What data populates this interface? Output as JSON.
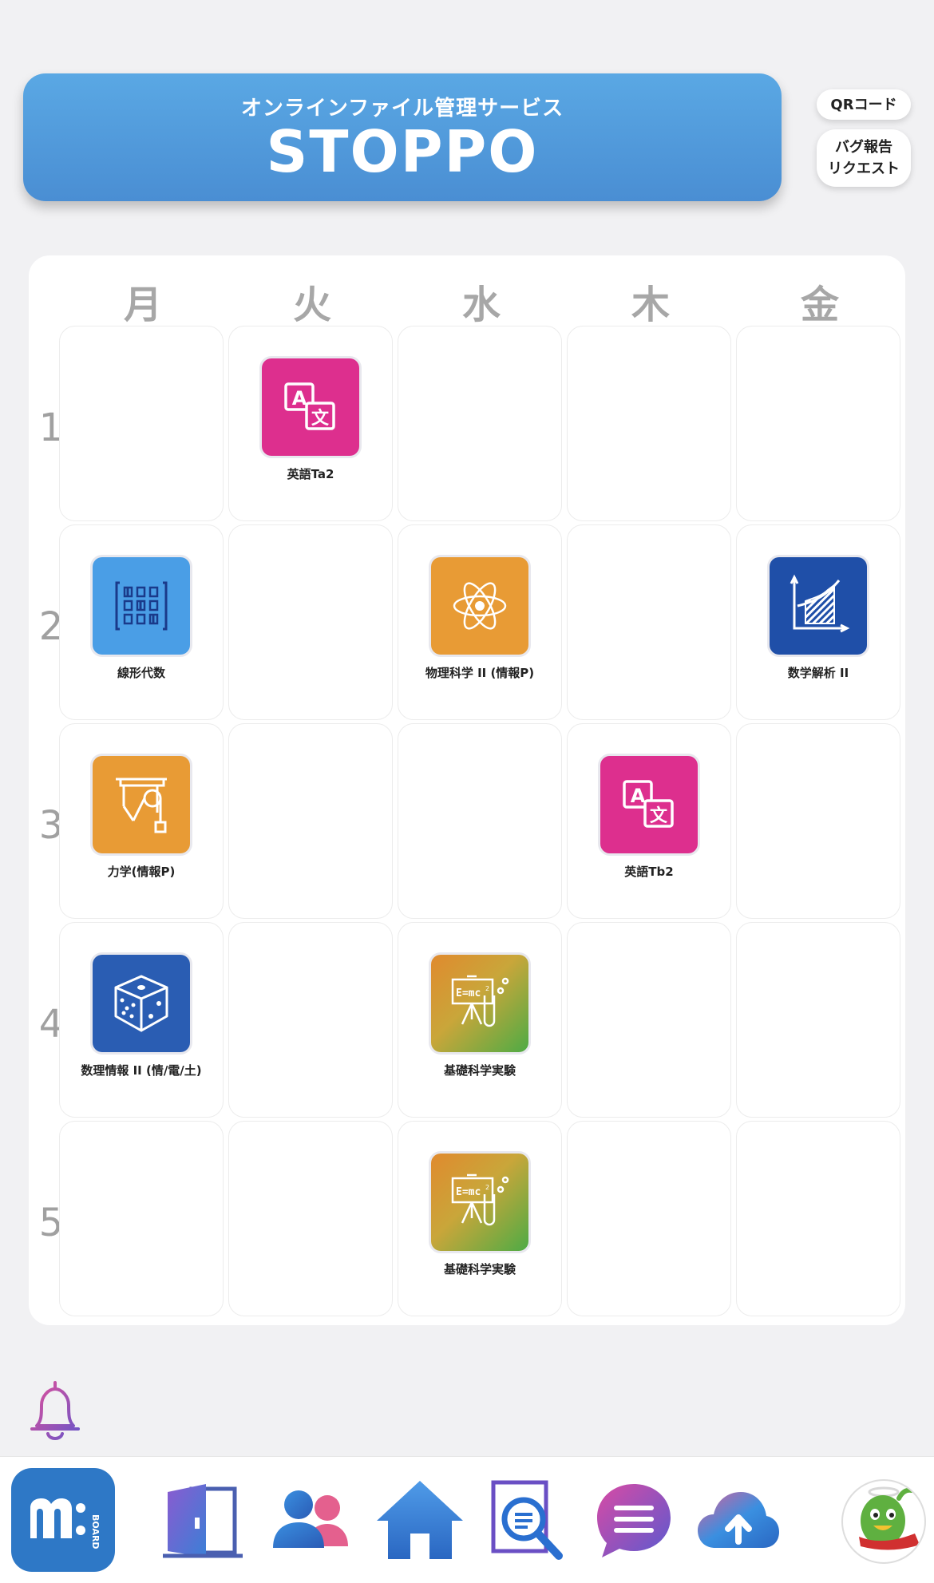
{
  "header": {
    "subtitle": "オンラインファイル管理サービス",
    "title": "STOPPO",
    "qr_label": "QRコード",
    "bug_label": "バグ報告\nリクエスト"
  },
  "days": [
    "月",
    "火",
    "水",
    "木",
    "金"
  ],
  "periods": [
    "1",
    "2",
    "3",
    "4",
    "5"
  ],
  "classes": [
    {
      "day": 1,
      "period": 0,
      "label": "英語Ta2",
      "icon": "translate-icon",
      "color": "#dd2f8e"
    },
    {
      "day": 0,
      "period": 1,
      "label": "線形代数",
      "icon": "matrix-icon",
      "color": "#4a9ee6"
    },
    {
      "day": 2,
      "period": 1,
      "label": "物理科学 II (情報P)",
      "icon": "atom-icon",
      "color": "#e89b35"
    },
    {
      "day": 4,
      "period": 1,
      "label": "数学解析 II",
      "icon": "integral-graph-icon",
      "color": "#1f4fa8"
    },
    {
      "day": 0,
      "period": 2,
      "label": "力学(情報P)",
      "icon": "pulley-icon",
      "color": "#e89b35"
    },
    {
      "day": 3,
      "period": 2,
      "label": "英語Tb2",
      "icon": "translate-icon",
      "color": "#dd2f8e"
    },
    {
      "day": 0,
      "period": 3,
      "label": "数理情報 II (情/電/土)",
      "icon": "dice-icon",
      "color": "#2a5db3"
    },
    {
      "day": 2,
      "period": 3,
      "label": "基礎科学実験",
      "icon": "science-experiment-icon",
      "color": "gradient"
    },
    {
      "day": 2,
      "period": 4,
      "label": "基礎科学実験",
      "icon": "science-experiment-icon",
      "color": "gradient"
    }
  ],
  "nav": {
    "items": [
      {
        "name": "mboard-app-icon",
        "label": "BOARD"
      },
      {
        "name": "door-icon"
      },
      {
        "name": "people-icon"
      },
      {
        "name": "home-icon"
      },
      {
        "name": "document-search-icon"
      },
      {
        "name": "chat-menu-icon"
      },
      {
        "name": "cloud-upload-icon"
      },
      {
        "name": "mascot-avatar-icon"
      }
    ]
  },
  "colors": {
    "banner": "#4f97da",
    "pink": "#dd2f8e",
    "orange": "#e89b35",
    "blue": "#4a9ee6",
    "navy": "#1f4fa8"
  }
}
